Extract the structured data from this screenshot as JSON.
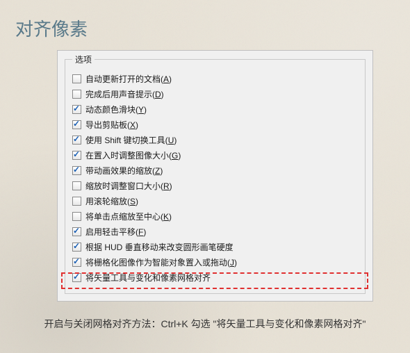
{
  "title": "对齐像素",
  "groupLabel": "选项",
  "options": [
    {
      "checked": false,
      "label": "自动更新打开的文档(",
      "accel": "A",
      "tail": ")"
    },
    {
      "checked": false,
      "label": "完成后用声音提示(",
      "accel": "D",
      "tail": ")"
    },
    {
      "checked": true,
      "label": "动态颜色滑块(",
      "accel": "Y",
      "tail": ")"
    },
    {
      "checked": true,
      "label": "导出剪贴板(",
      "accel": "X",
      "tail": ")"
    },
    {
      "checked": true,
      "label": "使用 Shift 键切换工具(",
      "accel": "U",
      "tail": ")"
    },
    {
      "checked": true,
      "label": "在置入时调整图像大小(",
      "accel": "G",
      "tail": ")"
    },
    {
      "checked": true,
      "label": "带动画效果的缩放(",
      "accel": "Z",
      "tail": ")"
    },
    {
      "checked": false,
      "label": "缩放时调整窗口大小(",
      "accel": "R",
      "tail": ")"
    },
    {
      "checked": false,
      "label": "用滚轮缩放(",
      "accel": "S",
      "tail": ")"
    },
    {
      "checked": false,
      "label": "将单击点缩放至中心(",
      "accel": "K",
      "tail": ")"
    },
    {
      "checked": true,
      "label": "启用轻击平移(",
      "accel": "F",
      "tail": ")"
    },
    {
      "checked": true,
      "label": "根据 HUD 垂直移动来改变圆形画笔硬度",
      "accel": "",
      "tail": ""
    },
    {
      "checked": true,
      "label": "将栅格化图像作为智能对象置入或拖动(",
      "accel": "J",
      "tail": ")"
    },
    {
      "checked": true,
      "label": "将矢量工具与变化和像素网格对齐",
      "accel": "",
      "tail": ""
    }
  ],
  "caption": "开启与关闭网格对齐方法：Ctrl+K 勾选 \"将矢量工具与变化和像素网格对齐\""
}
